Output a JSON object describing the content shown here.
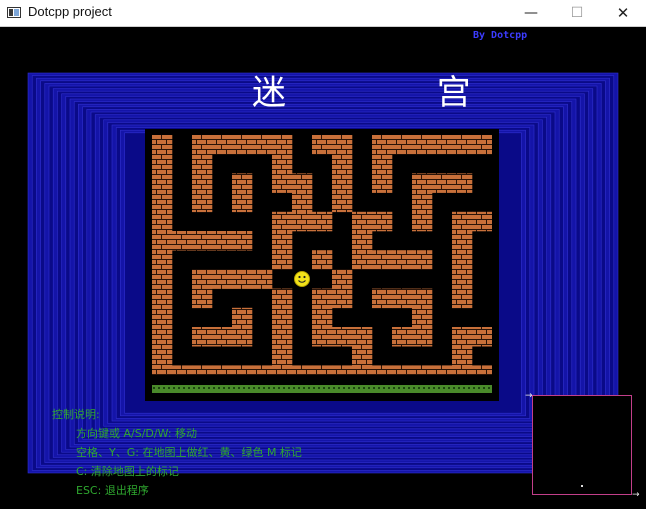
{
  "window": {
    "title": "Dotcpp project",
    "controls": {
      "minimize": "—",
      "maximize": "☐",
      "close": "✕"
    },
    "icon": "console-window-icon"
  },
  "game": {
    "author": "By Dotcpp",
    "title": "迷 宫",
    "player_icon": "smiley-face-icon",
    "colors": {
      "background": "#000000",
      "frame": "#1414a8",
      "brick": "#c8703a",
      "mortar": "#000000",
      "player": "#f2e21a",
      "grass": "#4a8a2a",
      "controls_text": "#2fa82f",
      "author_text": "#3c3cff",
      "minimap_border": "#c23f8a"
    }
  },
  "controls": {
    "heading": "控制说明:",
    "lines": [
      "方向键或 A/S/D/W: 移动",
      "空格、Y、G: 在地图上做红、黄、绿色 M 标记",
      "C: 清除地图上的标记",
      "ESC: 退出程序"
    ]
  },
  "maze": {
    "cols": 17,
    "rows": 13,
    "player": {
      "row": 7,
      "col": 7
    },
    "grid": [
      "#.#####.##.######",
      "#.#...#..#.#.....",
      "#.#.#.##.#.#.###.",
      "#.#.#..#.#...#...",
      "#.....###.##.#.##",
      "#####.#...#....#.",
      "#.....#.#.####.#.",
      "#.####...#.....#.",
      "#.#...#.##.###.#.",
      "#...#.#.#....#...",
      "#.###.#.###.##.##",
      "#.....#...#....#.",
      "#################"
    ]
  },
  "minimap": {
    "arrow_top": "→",
    "arrow_bottom": "→"
  }
}
